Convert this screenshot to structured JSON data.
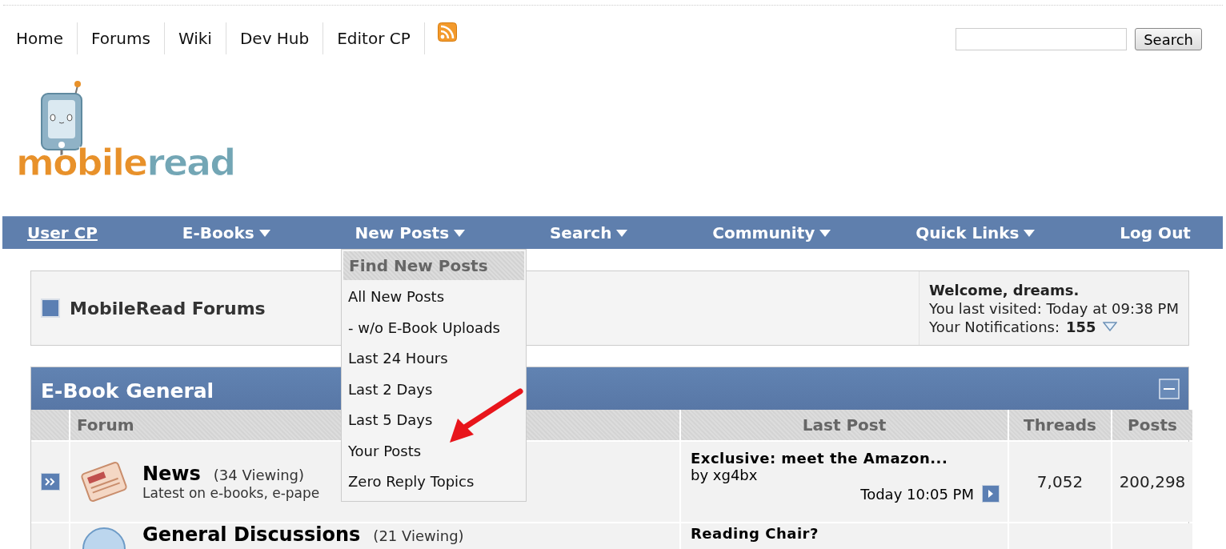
{
  "top_links": [
    "Home",
    "Forums",
    "Wiki",
    "Dev Hub",
    "Editor CP"
  ],
  "search": {
    "button": "Search"
  },
  "logo": {
    "first": "mobile",
    "second": "read"
  },
  "navbar": [
    {
      "label": "User CP",
      "dropdown": false,
      "underlined": true
    },
    {
      "label": "E-Books",
      "dropdown": true,
      "underlined": false
    },
    {
      "label": "New Posts",
      "dropdown": true,
      "underlined": false
    },
    {
      "label": "Search",
      "dropdown": true,
      "underlined": false
    },
    {
      "label": "Community",
      "dropdown": true,
      "underlined": false
    },
    {
      "label": "Quick Links",
      "dropdown": true,
      "underlined": false
    },
    {
      "label": "Log Out",
      "dropdown": false,
      "underlined": false
    }
  ],
  "dropdown_menu": {
    "heading": "Find New Posts",
    "items": [
      "All New Posts",
      "- w/o E-Book Uploads",
      "Last 24 Hours",
      "Last 2 Days",
      "Last 5 Days",
      "Your Posts",
      "Zero Reply Topics"
    ]
  },
  "breadcrumb": {
    "title": "MobileRead Forums"
  },
  "welcome": {
    "greeting": "Welcome, **dreams.**",
    "last_visited": "You last visited: Today at 09:38 PM",
    "notifications_label": "Your Notifications:",
    "notifications_count": "155"
  },
  "category": {
    "title": "E-Book General",
    "columns": [
      "Forum",
      "Last Post",
      "Threads",
      "Posts"
    ],
    "rows": [
      {
        "name": "News",
        "viewing": "(34 Viewing)",
        "description": "Latest on e-books, e-pape",
        "last_post_title": "Exclusive: meet the Amazon...",
        "last_post_by": "by xg4bx",
        "last_post_time": "Today 10:05 PM",
        "threads": "7,052",
        "posts": "200,298"
      },
      {
        "name": "General Discussions",
        "viewing": "(21 Viewing)",
        "last_post_title": "Reading Chair?"
      }
    ]
  }
}
